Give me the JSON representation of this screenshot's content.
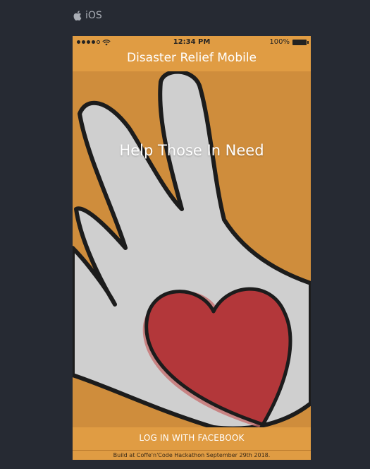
{
  "platform": {
    "icon": "apple-icon",
    "label": "iOS"
  },
  "status_bar": {
    "signal_icon": "signal-dots-icon",
    "wifi_icon": "wifi-icon",
    "time": "12:34 PM",
    "battery_percent": "100%",
    "battery_icon": "battery-icon"
  },
  "header": {
    "title": "Disaster Relief Mobile"
  },
  "hero": {
    "image": "hand-with-heart-illustration",
    "title": "Help Those In Need"
  },
  "actions": {
    "facebook_login_label": "LOG IN WITH FACEBOOK"
  },
  "footer": {
    "text": "Build at Coffe'n'Code Hackathon September 29th 2018."
  },
  "colors": {
    "page_background": "#262a33",
    "accent_orange": "#e09c43",
    "hero_background": "#cf8d3c",
    "hand": "#cfcfcf",
    "heart": "#b3373a"
  }
}
